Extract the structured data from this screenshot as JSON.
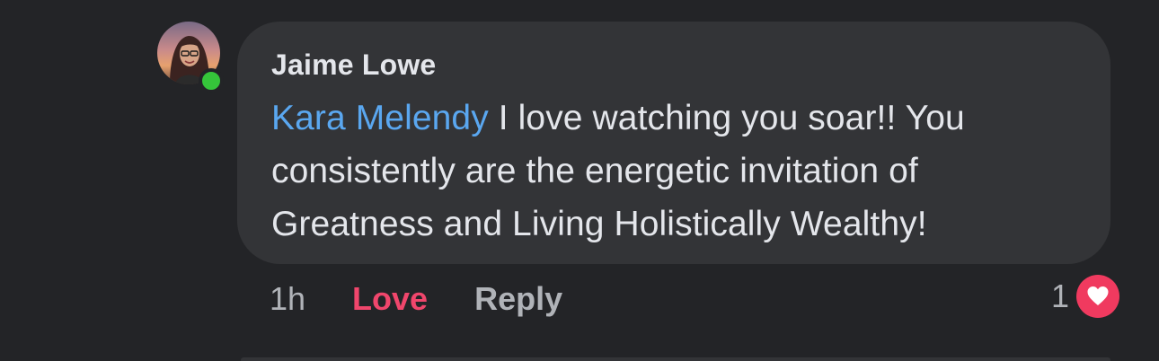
{
  "comment": {
    "author": "Jaime Lowe",
    "mention": "Kara Melendy",
    "text": " I love watching you soar!! You consistently are the energetic invitation of Greatness and Living Holistically Wealthy!",
    "timestamp": "1h",
    "love_label": "Love",
    "reply_label": "Reply",
    "reaction_count": "1",
    "reaction_icon": "heart-icon",
    "author_online": true
  },
  "colors": {
    "background": "#232427",
    "bubble": "#333437",
    "mention": "#5aa7f0",
    "love": "#f0466c",
    "online": "#35c53a",
    "heart_badge": "#f03a5f"
  }
}
